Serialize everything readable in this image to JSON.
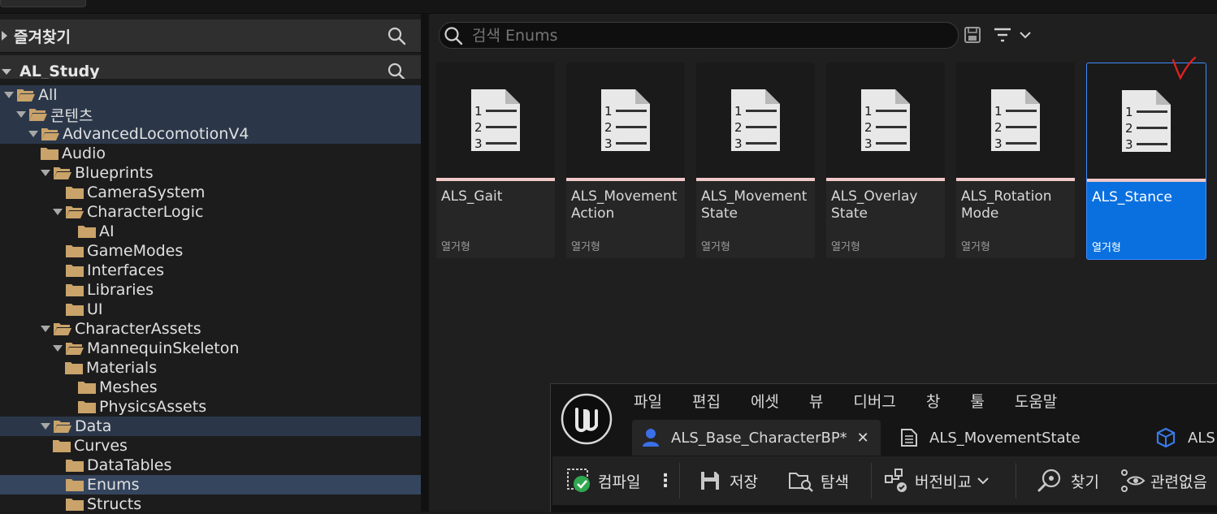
{
  "favorites": {
    "title": "즐겨찾기"
  },
  "project": {
    "title": "AL_Study"
  },
  "tree": [
    {
      "label": "All",
      "indent": 0,
      "arrow": "down",
      "open": true,
      "hl": true
    },
    {
      "label": "콘텐츠",
      "indent": 1,
      "arrow": "down",
      "open": true,
      "hl": true
    },
    {
      "label": "AdvancedLocomotionV4",
      "indent": 2,
      "arrow": "down",
      "open": true,
      "hl": true
    },
    {
      "label": "Audio",
      "indent": 3,
      "arrow": "right",
      "open": false,
      "hl": false
    },
    {
      "label": "Blueprints",
      "indent": 3,
      "arrow": "down",
      "open": true,
      "hl": false
    },
    {
      "label": "CameraSystem",
      "indent": 4,
      "arrow": "none",
      "open": false,
      "hl": false
    },
    {
      "label": "CharacterLogic",
      "indent": 4,
      "arrow": "down",
      "open": true,
      "hl": false
    },
    {
      "label": "AI",
      "indent": 5,
      "arrow": "none",
      "open": false,
      "hl": false
    },
    {
      "label": "GameModes",
      "indent": 4,
      "arrow": "none",
      "open": false,
      "hl": false
    },
    {
      "label": "Interfaces",
      "indent": 4,
      "arrow": "none",
      "open": false,
      "hl": false
    },
    {
      "label": "Libraries",
      "indent": 4,
      "arrow": "none",
      "open": false,
      "hl": false
    },
    {
      "label": "UI",
      "indent": 4,
      "arrow": "none",
      "open": false,
      "hl": false
    },
    {
      "label": "CharacterAssets",
      "indent": 3,
      "arrow": "down",
      "open": true,
      "hl": false
    },
    {
      "label": "MannequinSkeleton",
      "indent": 4,
      "arrow": "down",
      "open": true,
      "hl": false
    },
    {
      "label": "Materials",
      "indent": 5,
      "arrow": "right",
      "open": false,
      "hl": false
    },
    {
      "label": "Meshes",
      "indent": 5,
      "arrow": "none",
      "open": false,
      "hl": false
    },
    {
      "label": "PhysicsAssets",
      "indent": 5,
      "arrow": "none",
      "open": false,
      "hl": false
    },
    {
      "label": "Data",
      "indent": 3,
      "arrow": "down",
      "open": true,
      "hl": true
    },
    {
      "label": "Curves",
      "indent": 4,
      "arrow": "right",
      "open": false,
      "hl": false
    },
    {
      "label": "DataTables",
      "indent": 4,
      "arrow": "none",
      "open": false,
      "hl": false
    },
    {
      "label": "Enums",
      "indent": 4,
      "arrow": "none",
      "open": false,
      "hl": false,
      "sel": true
    },
    {
      "label": "Structs",
      "indent": 4,
      "arrow": "none",
      "open": false,
      "hl": false
    }
  ],
  "search": {
    "placeholder": "검색 Enums"
  },
  "assets": [
    {
      "name": "ALS_Gait",
      "type": "열거형",
      "selected": false
    },
    {
      "name": "ALS_Movement Action",
      "type": "열거형",
      "selected": false
    },
    {
      "name": "ALS_Movement State",
      "type": "열거형",
      "selected": false
    },
    {
      "name": "ALS_Overlay State",
      "type": "열거형",
      "selected": false
    },
    {
      "name": "ALS_Rotation Mode",
      "type": "열거형",
      "selected": false
    },
    {
      "name": "ALS_Stance",
      "type": "열거형",
      "selected": true
    }
  ],
  "editor": {
    "menu": [
      "파일",
      "편집",
      "에셋",
      "뷰",
      "디버그",
      "창",
      "툴",
      "도움말"
    ],
    "tabs": [
      {
        "label": "ALS_Base_CharacterBP*",
        "active": true
      },
      {
        "label": "ALS_MovementState",
        "active": false
      },
      {
        "label": "ALS",
        "active": false
      }
    ],
    "toolbar": {
      "compile": "컴파일",
      "save": "저장",
      "browse": "탐색",
      "diff": "버전비교",
      "find": "찾기",
      "hide_unrelated": "관련없음"
    }
  },
  "colors": {
    "accent": "#0a70e0",
    "folder": "#c9a36a",
    "enum_bar": "#f0c8c8",
    "check": "#e02020"
  }
}
